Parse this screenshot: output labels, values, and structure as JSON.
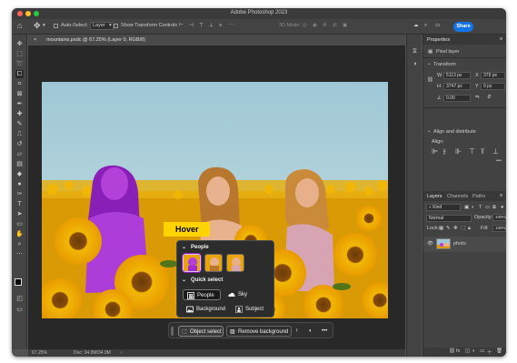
{
  "window": {
    "title": "Adobe Photoshop 2023",
    "traffic_lights": [
      "#ff5f57",
      "#febc2e",
      "#28c840"
    ]
  },
  "options_bar": {
    "auto_select_label": "Auto-Select:",
    "layer_select": "Layer",
    "show_transform_label": "Show Transform Controls",
    "mode_3d_label": "3D Mode:",
    "share_label": "Share"
  },
  "document": {
    "tab_title": "mountains.psdc @ 67.25% (Layer 0, RGB/8)",
    "zoom": "67.25%",
    "doc_size": "Doc: 34.9M/34.9M"
  },
  "tools": [
    "move-icon",
    "marquee-icon",
    "lasso-icon",
    "object-select-icon",
    "crop-icon",
    "frame-icon",
    "eyedropper-icon",
    "healing-icon",
    "brush-icon",
    "stamp-icon",
    "history-brush-icon",
    "eraser-icon",
    "gradient-icon",
    "blur-icon",
    "dodge-icon",
    "pen-icon",
    "type-icon",
    "path-select-icon",
    "shape-icon",
    "hand-icon",
    "zoom-icon",
    "more-icon"
  ],
  "hover_tag": "Hover",
  "selection_popup": {
    "people_header": "People",
    "quick_select_header": "Quick select",
    "buttons": [
      {
        "label": "People",
        "icon": "people-icon",
        "active": true
      },
      {
        "label": "Sky",
        "icon": "cloud-icon",
        "active": false
      },
      {
        "label": "Background",
        "icon": "image-icon",
        "active": false
      },
      {
        "label": "Subject",
        "icon": "subject-icon",
        "active": false
      }
    ]
  },
  "context_bar": {
    "object_select": "Object select",
    "remove_background": "Remove background"
  },
  "properties": {
    "tab": "Properties",
    "kind": "Pixel layer",
    "transform_header": "Transform",
    "w_label": "W",
    "w_value": "5113 px",
    "h_label": "H",
    "h_value": "3747 px",
    "x_label": "X",
    "x_value": "379 px",
    "y_label": "Y",
    "y_value": "0 px",
    "angle": "0.00",
    "align_header": "Align and distribute",
    "align_label": "Align:"
  },
  "layers": {
    "tabs": [
      "Layers",
      "Channels",
      "Paths"
    ],
    "filter": "Kind",
    "blend_mode": "Normal",
    "opacity_label": "Opacity:",
    "opacity_value": "100%",
    "lock_label": "Lock:",
    "fill_label": "Fill:",
    "fill_value": "100%",
    "layer_name": "photo"
  },
  "colors": {
    "accent": "#1473e6",
    "hover_tag": "#ffd400",
    "selection_overlay": "#a020c8",
    "panel_bg": "#424242"
  }
}
